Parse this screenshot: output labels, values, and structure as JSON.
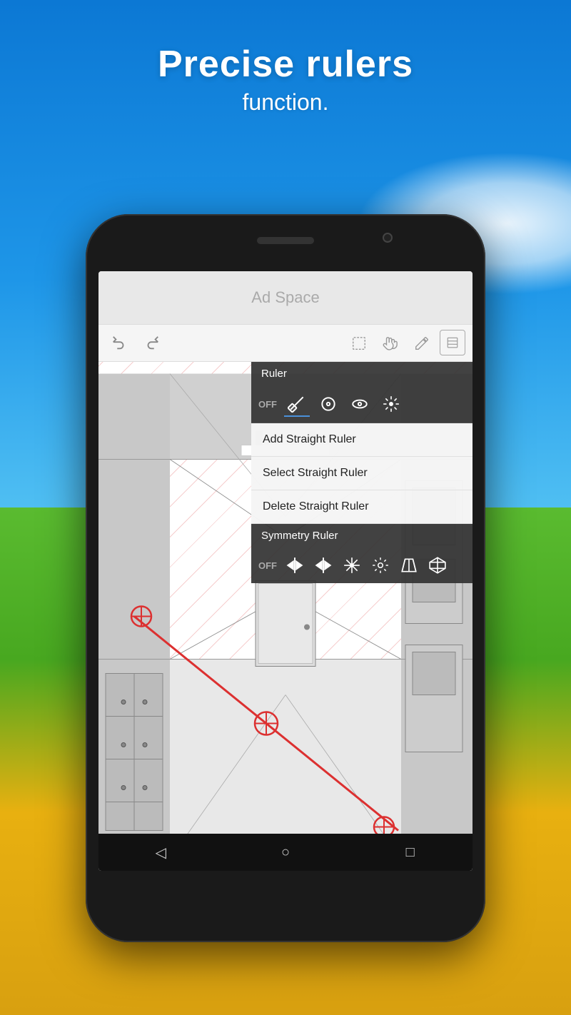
{
  "header": {
    "title": "Precise rulers",
    "subtitle": "function."
  },
  "ad": {
    "text": "Ad Space"
  },
  "toolbar": {
    "undo": "↩",
    "redo": "↪",
    "select": "⬚",
    "hand": "✋",
    "pen": "✏",
    "layers": "📋"
  },
  "ruler_menu": {
    "ruler_header": "Ruler",
    "off_label": "OFF",
    "menu_items": [
      "Add Straight Ruler",
      "Select Straight Ruler",
      "Delete Straight Ruler"
    ],
    "symmetry_header": "Symmetry Ruler",
    "symmetry_off": "OFF"
  },
  "nav": {
    "back": "◁",
    "home": "○",
    "recent": "□"
  }
}
